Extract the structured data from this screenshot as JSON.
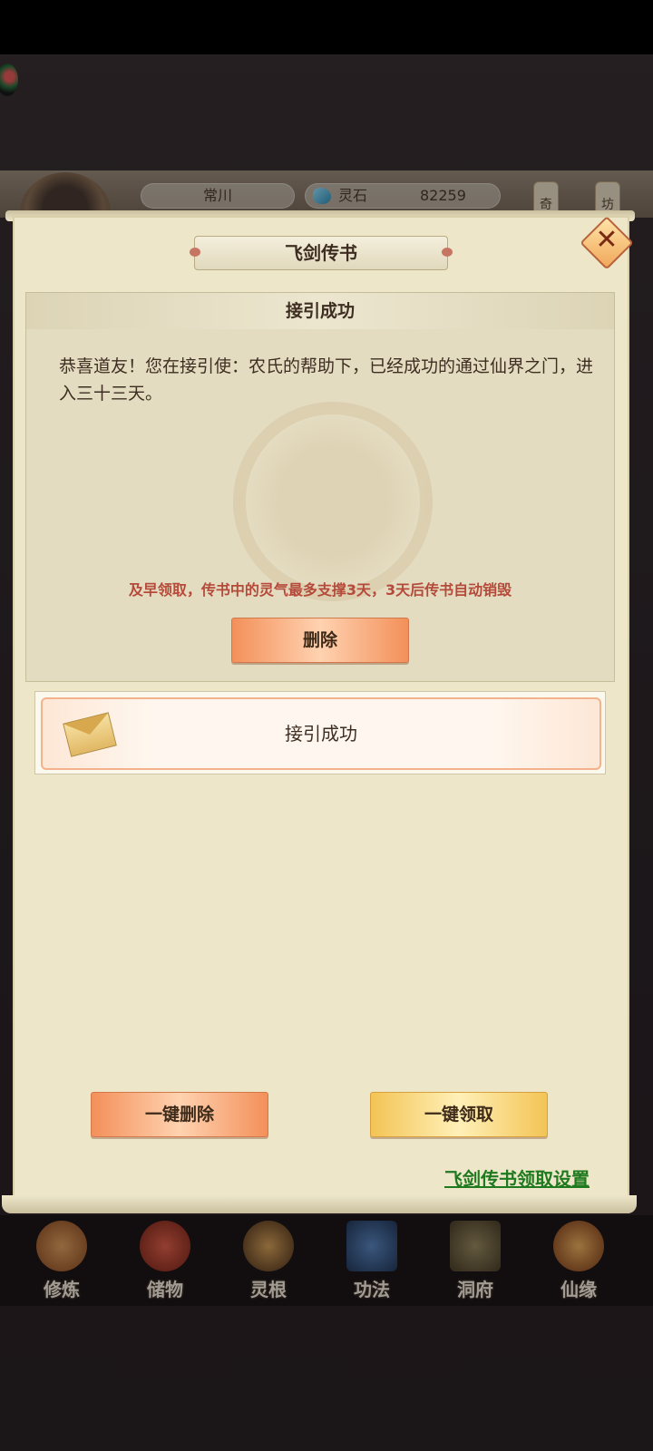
{
  "hud": {
    "player_name": "常川",
    "resource_label": "灵石",
    "resource_value": "82259",
    "badge_1": "奇",
    "badge_2": "坊"
  },
  "dialog": {
    "title": "飞剑传书",
    "close_icon": "close-icon",
    "detail": {
      "title": "接引成功",
      "body": "恭喜道友！您在接引使：农氏的帮助下，已经成功的通过仙界之门，进入三十三天。",
      "warning": "及早领取，传书中的灵气最多支撑3天，3天后传书自动销毁",
      "delete_label": "删除"
    },
    "mail_list": [
      {
        "title": "接引成功",
        "icon": "envelope-icon"
      }
    ],
    "delete_all_label": "一键删除",
    "claim_all_label": "一键领取",
    "settings_link": "飞剑传书领取设置"
  },
  "bottom_nav": [
    {
      "label": "修炼",
      "icon": "cultivate-icon",
      "color": "#c87a3a"
    },
    {
      "label": "储物",
      "icon": "storage-bag-icon",
      "color": "#c0452e"
    },
    {
      "label": "灵根",
      "icon": "spirit-root-icon",
      "color": "#6b4a2e"
    },
    {
      "label": "功法",
      "icon": "technique-book-icon",
      "color": "#355a8a"
    },
    {
      "label": "洞府",
      "icon": "cave-dwelling-icon",
      "color": "#6a5a3e"
    },
    {
      "label": "仙缘",
      "icon": "immortal-fate-icon",
      "color": "#b86a2e"
    }
  ]
}
